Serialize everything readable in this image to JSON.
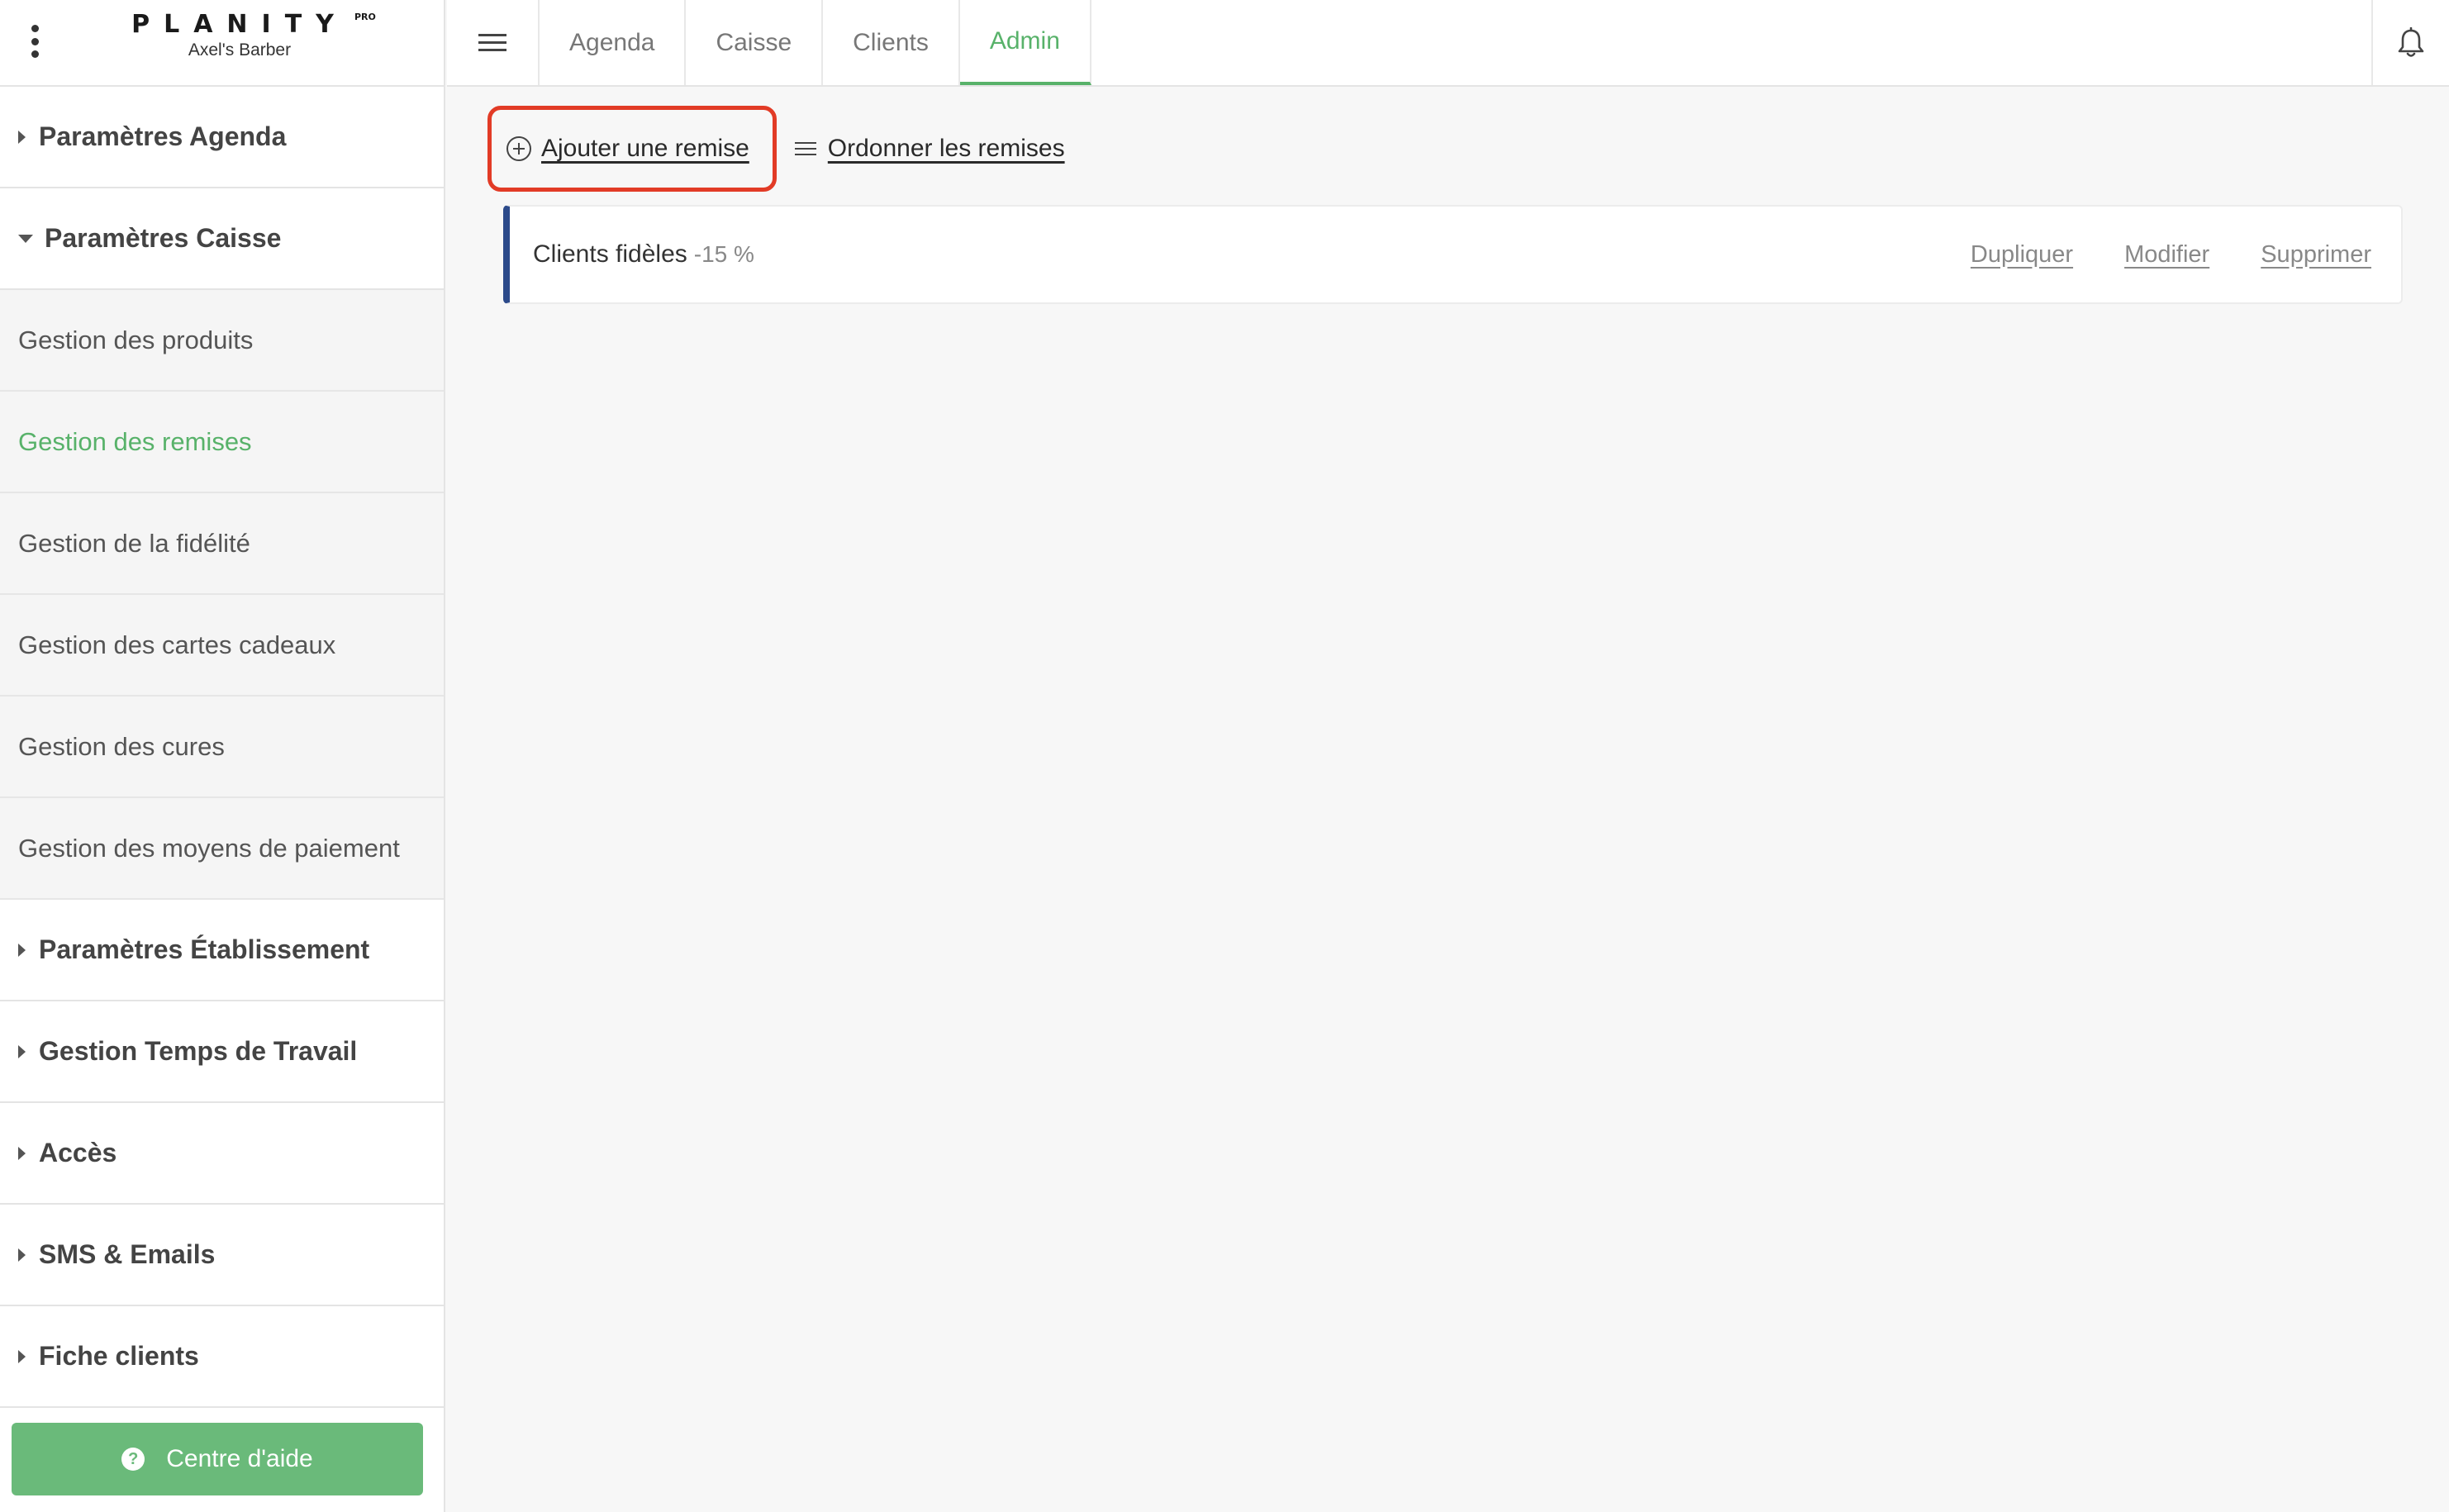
{
  "brand": {
    "name": "PLANITY",
    "badge": "PRO",
    "salon": "Axel's Barber"
  },
  "sidebar": {
    "items": [
      {
        "type": "section",
        "label": "Paramètres Agenda",
        "expanded": false
      },
      {
        "type": "section",
        "label": "Paramètres Caisse",
        "expanded": true
      },
      {
        "type": "sub",
        "label": "Gestion des produits",
        "active": false
      },
      {
        "type": "sub",
        "label": "Gestion des remises",
        "active": true
      },
      {
        "type": "sub",
        "label": "Gestion de la fidélité",
        "active": false
      },
      {
        "type": "sub",
        "label": "Gestion des cartes cadeaux",
        "active": false
      },
      {
        "type": "sub",
        "label": "Gestion des cures",
        "active": false
      },
      {
        "type": "sub",
        "label": "Gestion des moyens de paiement",
        "active": false
      },
      {
        "type": "section",
        "label": "Paramètres Établissement",
        "expanded": false
      },
      {
        "type": "section",
        "label": "Gestion Temps de Travail",
        "expanded": false
      },
      {
        "type": "section",
        "label": "Accès",
        "expanded": false
      },
      {
        "type": "section",
        "label": "SMS & Emails",
        "expanded": false
      },
      {
        "type": "section",
        "label": "Fiche clients",
        "expanded": false
      }
    ],
    "help_label": "Centre d'aide",
    "help_icon_glyph": "?"
  },
  "topbar": {
    "tabs": [
      {
        "label": "Agenda",
        "active": false
      },
      {
        "label": "Caisse",
        "active": false
      },
      {
        "label": "Clients",
        "active": false
      },
      {
        "label": "Admin",
        "active": true
      }
    ]
  },
  "toolbar": {
    "add_label": "Ajouter une remise",
    "order_label": "Ordonner les remises"
  },
  "discounts": [
    {
      "name": "Clients fidèles",
      "value": "-15 %",
      "actions": {
        "duplicate": "Dupliquer",
        "edit": "Modifier",
        "delete": "Supprimer"
      }
    }
  ],
  "colors": {
    "accent_green": "#58b26a",
    "help_button": "#6aba7a",
    "highlight_red": "#e23b26",
    "card_accent_blue": "#2c4a8a"
  }
}
